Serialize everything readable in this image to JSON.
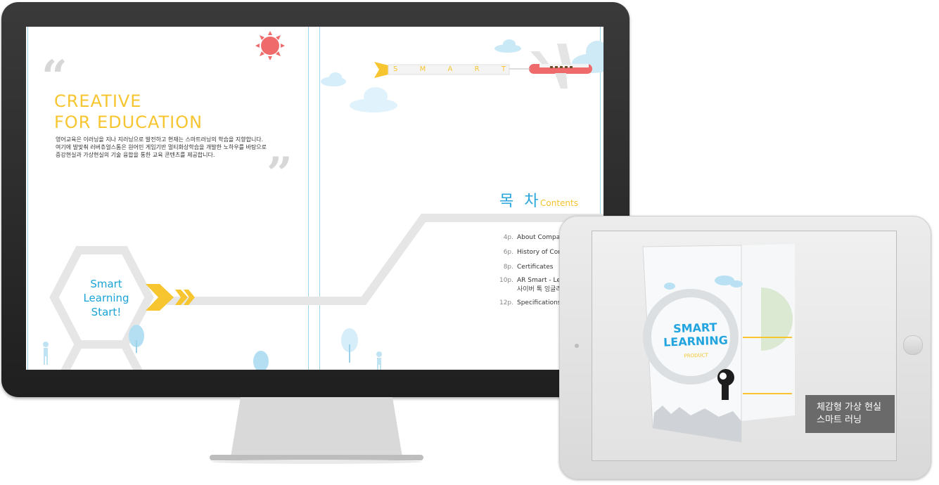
{
  "left_page": {
    "headline_line1": "CREATIVE",
    "headline_line2": "FOR EDUCATION",
    "intro_lines": [
      "영어교육은 이러닝을 지나 지러닝으로 발전하고 현재는 스마트러닝의 학습을 지향합니다.",
      "여기에 발맞춰 러버츄얼스톰은 원어민 게임기반 멀티화상학습을 개발한 노하우를 바탕으로",
      "증강현실과 가상현실의 기술 융합을 통한 교육 콘텐츠를 제공합니다."
    ],
    "hexagon_text_lines": [
      "Smart",
      "Learning",
      "Start!"
    ]
  },
  "right_page": {
    "banner_letters": [
      "S",
      "M",
      "A",
      "R",
      "T"
    ],
    "contents_title_ko": "목 차",
    "contents_title_en": "Contents",
    "toc": [
      {
        "page": "4p.",
        "label": "About Compar"
      },
      {
        "page": "6p.",
        "label": "History of Com"
      },
      {
        "page": "8p.",
        "label": "Certificates"
      },
      {
        "page": "10p.",
        "label": "AR Smart - Lea",
        "sub": "사이버 톡 잉글리쉬"
      },
      {
        "page": "12p.",
        "label": "Specifications"
      }
    ]
  },
  "tablet": {
    "brochure_title_line1": "SMART",
    "brochure_title_line2": "LEARNING",
    "brochure_subtitle": "PRODUCT",
    "caption_line1": "체감형 가상 현실",
    "caption_line2": "스마트 러닝"
  },
  "colors": {
    "accent_yellow": "#f7c52f",
    "accent_blue": "#29a7dd",
    "sun_red": "#ef6b6b"
  }
}
